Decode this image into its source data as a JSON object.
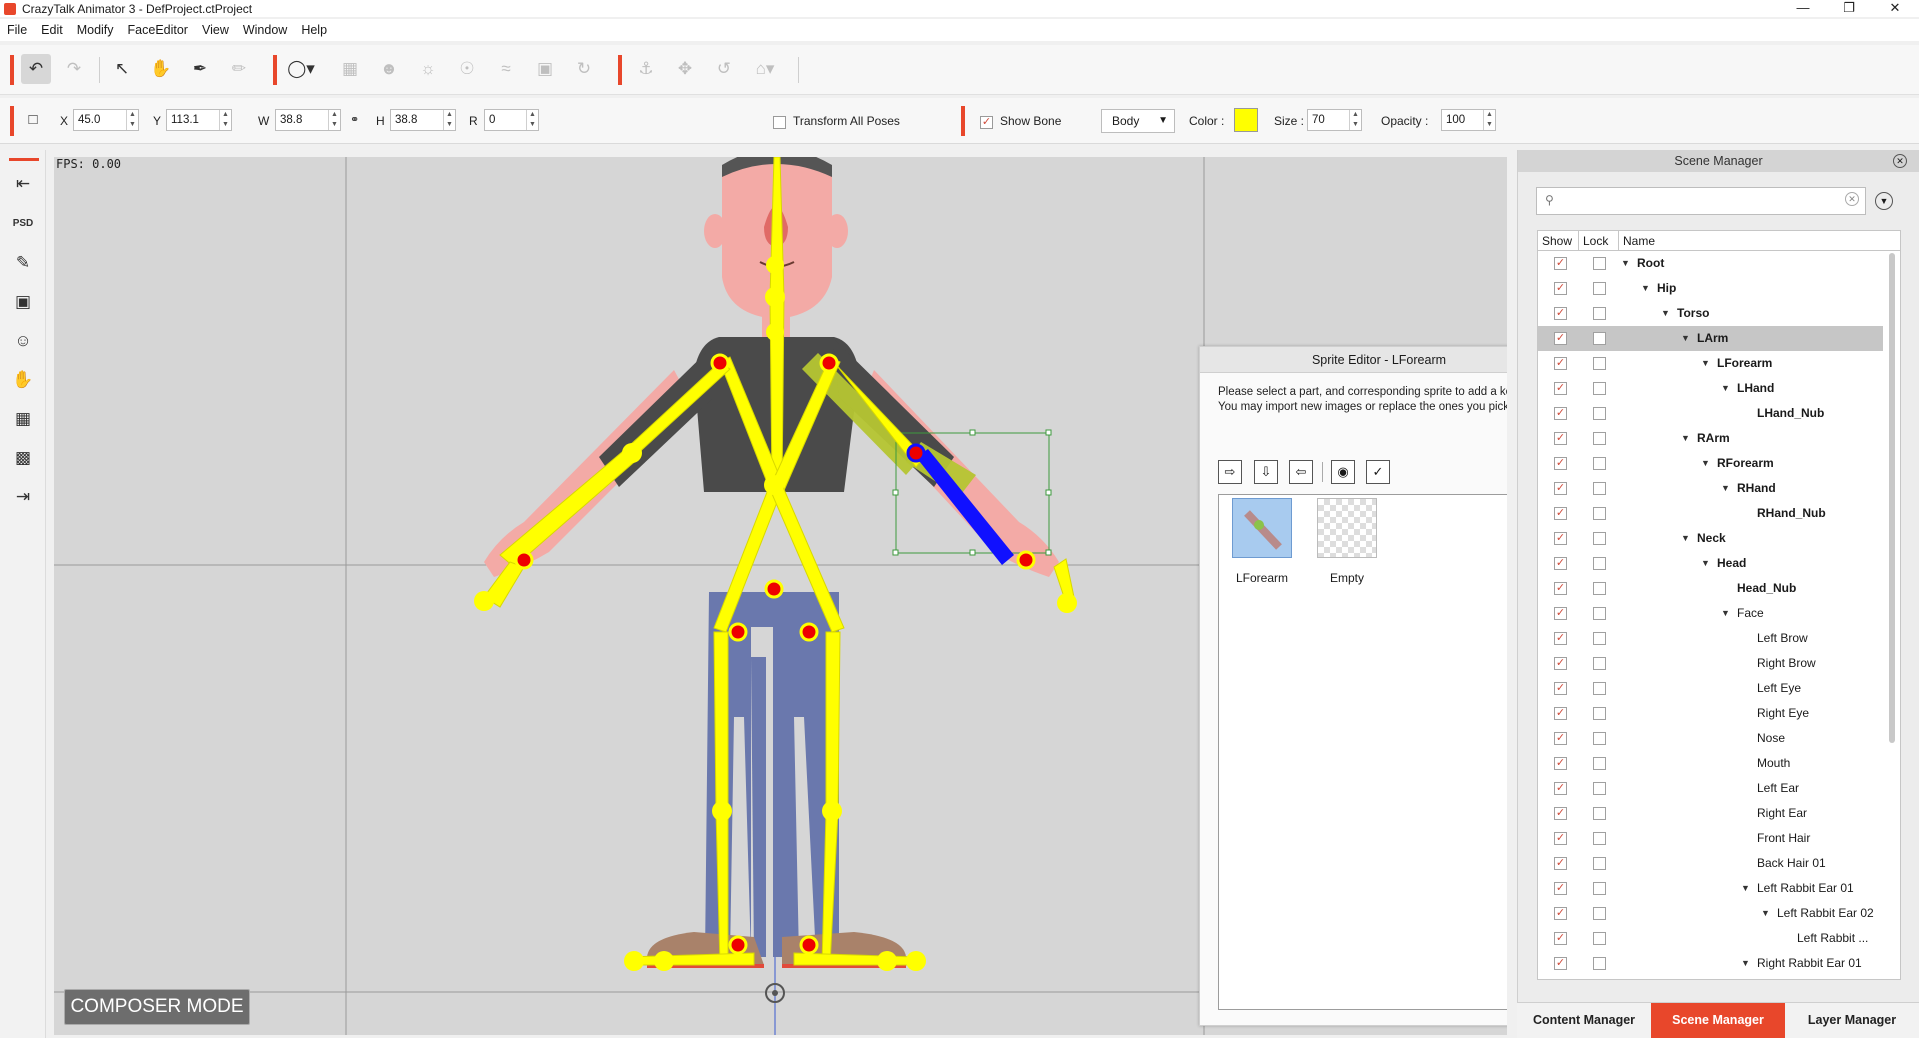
{
  "window": {
    "title": "CrazyTalk Animator 3   - DefProject.ctProject"
  },
  "menu": [
    "File",
    "Edit",
    "Modify",
    "FaceEditor",
    "View",
    "Window",
    "Help"
  ],
  "transform": {
    "x_label": "X",
    "x": "45.0",
    "y_label": "Y",
    "y": "113.1",
    "w_label": "W",
    "w": "38.8",
    "h_label": "H",
    "h": "38.8",
    "r_label": "R",
    "r": "0",
    "transform_all_poses": "Transform All Poses",
    "show_bone": "Show Bone",
    "body_select": "Body",
    "color_label": "Color :",
    "color": "#ffff00",
    "size_label": "Size :",
    "size": "70",
    "opacity_label": "Opacity :",
    "opacity": "100"
  },
  "viewport": {
    "fps": "FPS: 0.00",
    "mode": "COMPOSER MODE"
  },
  "sprite_editor": {
    "title": "Sprite Editor - LForearm",
    "message": "Please select a part, and corresponding sprite to add a key.\nYou may import new images or replace the ones you picked.",
    "sprites": [
      "LForearm",
      "Empty"
    ]
  },
  "scene_manager": {
    "title": "Scene Manager",
    "columns": {
      "show": "Show",
      "lock": "Lock",
      "name": "Name"
    },
    "rows": [
      {
        "name": "Root"
      },
      {
        "name": "Hip"
      },
      {
        "name": "Torso"
      },
      {
        "name": "LArm"
      },
      {
        "name": "LForearm"
      },
      {
        "name": "LHand"
      },
      {
        "name": "LHand_Nub"
      },
      {
        "name": "RArm"
      },
      {
        "name": "RForearm"
      },
      {
        "name": "RHand"
      },
      {
        "name": "RHand_Nub"
      },
      {
        "name": "Neck"
      },
      {
        "name": "Head"
      },
      {
        "name": "Head_Nub"
      },
      {
        "name": "Face"
      },
      {
        "name": "Left Brow"
      },
      {
        "name": "Right Brow"
      },
      {
        "name": "Left Eye"
      },
      {
        "name": "Right Eye"
      },
      {
        "name": "Nose"
      },
      {
        "name": "Mouth"
      },
      {
        "name": "Left Ear"
      },
      {
        "name": "Right Ear"
      },
      {
        "name": "Front Hair"
      },
      {
        "name": "Back Hair 01"
      },
      {
        "name": "Left Rabbit Ear 01"
      },
      {
        "name": "Left Rabbit Ear 02"
      },
      {
        "name": "Left Rabbit ..."
      },
      {
        "name": "Right Rabbit Ear 01"
      }
    ]
  },
  "tabs": [
    "Content Manager",
    "Scene Manager",
    "Layer Manager"
  ]
}
